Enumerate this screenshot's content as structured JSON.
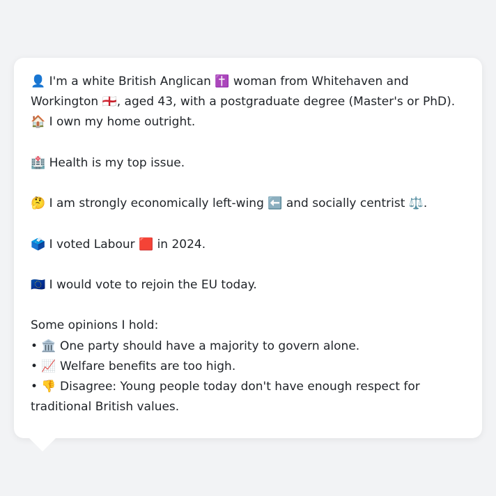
{
  "profile": {
    "intro": "👤 I'm a white British Anglican ✝️ woman from Whitehaven and Workington 🏴󠁧󠁢󠁥󠁮󠁧󠁿, aged 43, with a postgraduate degree (Master's or PhD). 🏠 I own my home outright.",
    "health": "🏥 Health is my top issue.",
    "ideology": "🤔 I am strongly economically left-wing ⬅️ and socially centrist ⚖️.",
    "vote": "🗳️ I voted Labour 🟥 in 2024.",
    "eu": "🇪🇺 I would vote to rejoin the EU today.",
    "opinions_heading": "Some opinions I hold:",
    "opinions": [
      "• 🏛️ One party should have a majority to govern alone.",
      "• 📈 Welfare benefits are too high.",
      "• 👎 Disagree: Young people today don't have enough respect for traditional British values."
    ]
  },
  "colors": {
    "background": "#f2f3f5",
    "bubble": "#ffffff",
    "text": "#1f2328"
  }
}
